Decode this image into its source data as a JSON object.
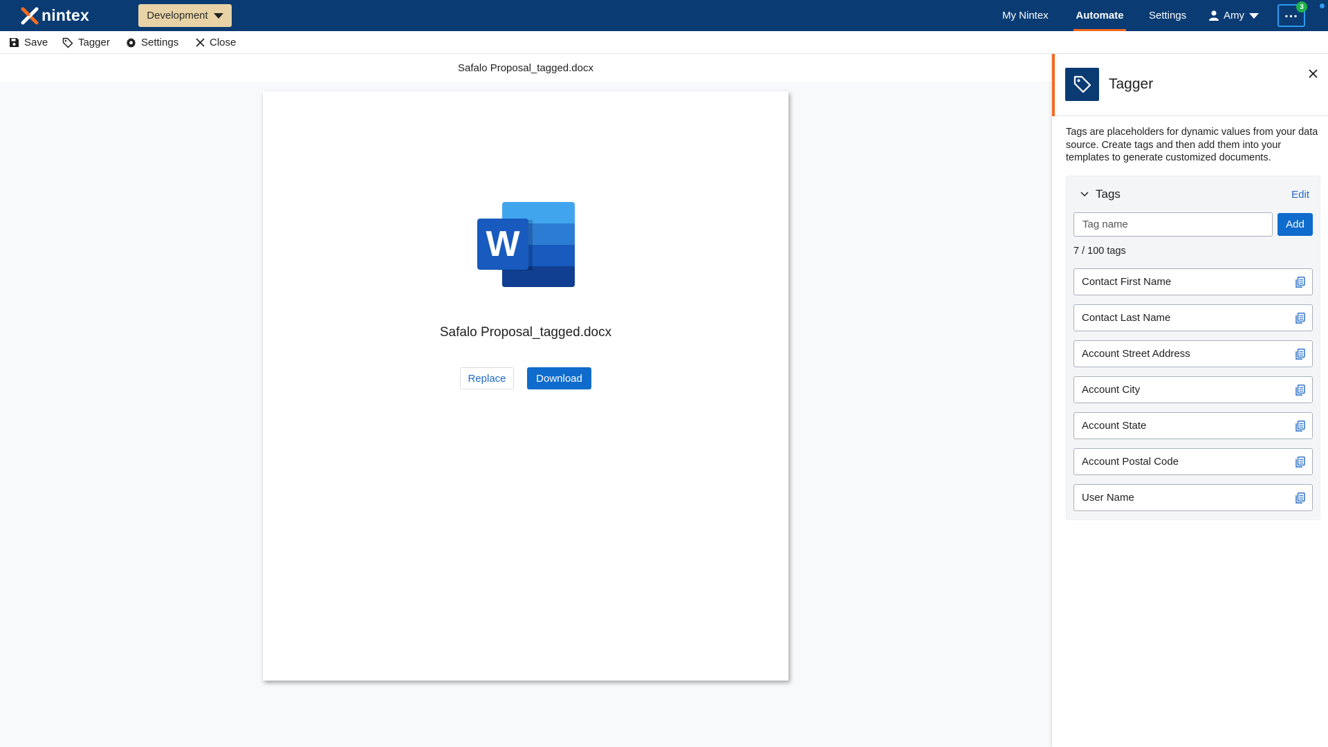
{
  "topbar": {
    "logo_text": "nintex",
    "environment": "Development",
    "nav_links": [
      "My Nintex",
      "Automate",
      "Settings"
    ],
    "active_link": "Automate",
    "user_name": "Amy",
    "notification_count": "3",
    "accent_color": "#f26b21",
    "bar_color": "#0a3b73"
  },
  "toolbar": {
    "save_label": "Save",
    "tagger_label": "Tagger",
    "settings_label": "Settings",
    "close_label": "Close"
  },
  "document": {
    "filename_bar": "Safalo Proposal_tagged.docx",
    "title": "Safalo Proposal_tagged.docx",
    "file_icon": "word-icon",
    "replace_label": "Replace",
    "download_label": "Download"
  },
  "tagger": {
    "title": "Tagger",
    "description": "Tags are placeholders for dynamic values from your data source. Create tags and then add them into your templates to generate customized documents.",
    "tags_heading": "Tags",
    "edit_label": "Edit",
    "input_placeholder": "Tag name",
    "add_label": "Add",
    "count_text": "7 / 100 tags",
    "tags": [
      "Contact First Name",
      "Contact Last Name",
      "Account Street Address",
      "Account City",
      "Account State",
      "Account Postal Code",
      "User Name"
    ]
  }
}
